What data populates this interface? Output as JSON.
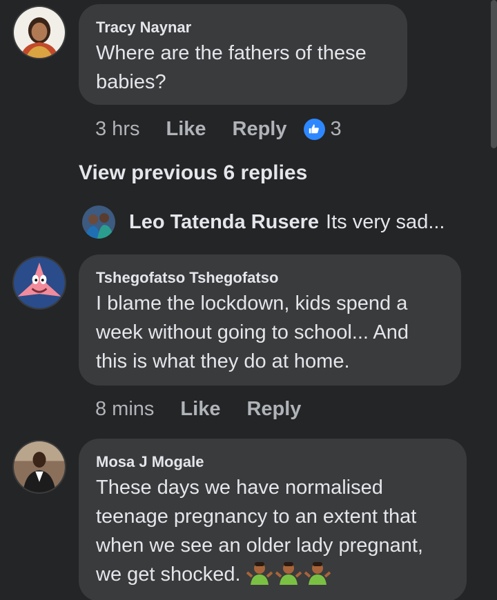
{
  "comments": [
    {
      "author": "Tracy Naynar",
      "text": "Where are the fathers of these babies?",
      "time": "3 hrs",
      "like_label": "Like",
      "reply_label": "Reply",
      "like_count": "3",
      "avatar": "woman-portrait-avatar"
    },
    {
      "author": "Tshegofatso Tshegofatso",
      "text": "I blame the lockdown, kids spend a week without going to school... And this is what they do at home.",
      "time": "8 mins",
      "like_label": "Like",
      "reply_label": "Reply",
      "avatar": "patrick-star-avatar"
    },
    {
      "author": "Mosa J Mogale",
      "text": "These days we have normalised teenage pregnancy to an extent that when we see an older lady pregnant, we get shocked.",
      "emoji": [
        "man-shrugging-emoji",
        "man-shrugging-emoji",
        "man-shrugging-emoji"
      ],
      "avatar": "man-in-vest-avatar"
    }
  ],
  "view_previous": "View previous 6 replies",
  "reply_preview": {
    "author": "Leo Tatenda Rusere",
    "text": "Its very sad..."
  },
  "colors": {
    "background": "#242526",
    "bubble": "#3a3b3c",
    "text": "#e4e6eb",
    "muted": "#b0b3b8",
    "like_blue": "#2d88ff"
  }
}
